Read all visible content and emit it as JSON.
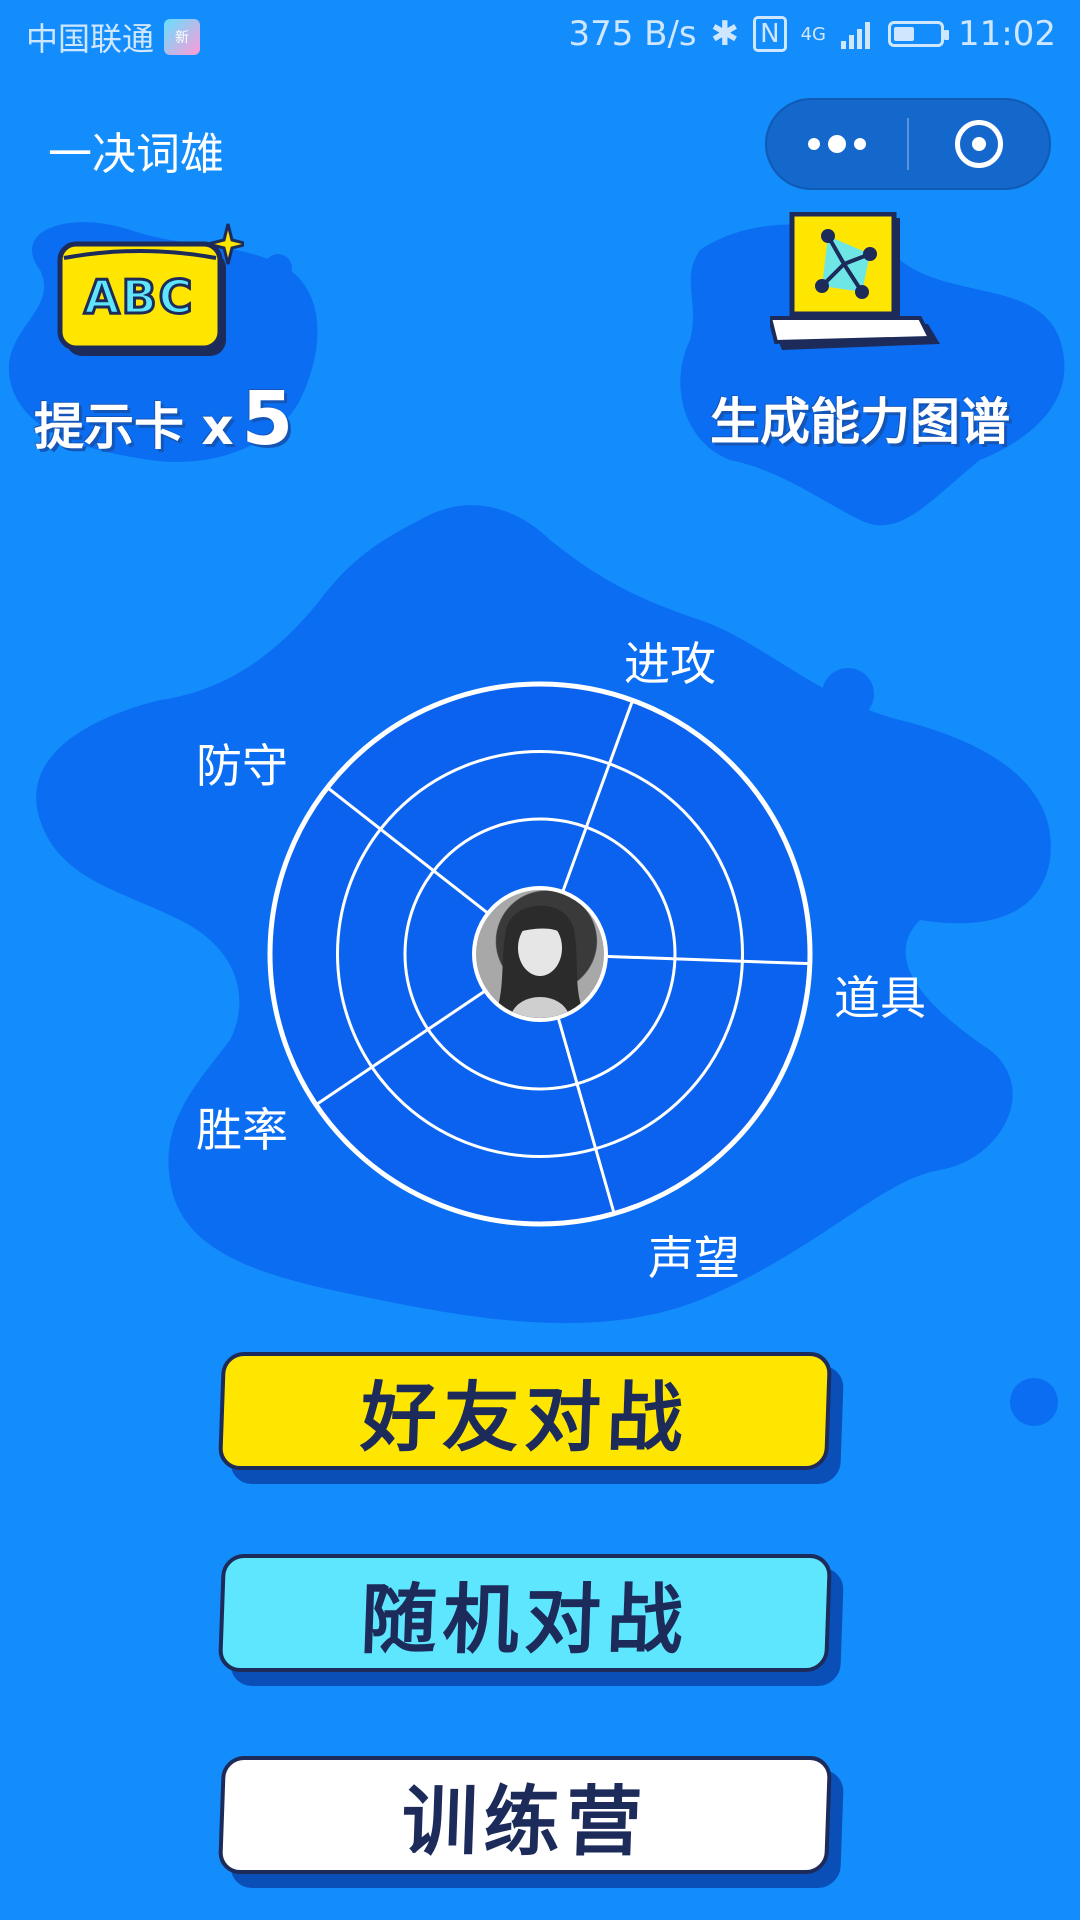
{
  "status_bar": {
    "carrier": "中国联通",
    "carrier_badge": "新",
    "net_speed": "375 B/s",
    "network": "4G",
    "time": "11:02",
    "battery_level": 0.45
  },
  "header": {
    "title": "一决词雄"
  },
  "tools": {
    "hint_card_label": "提示卡 x",
    "hint_card_count": "5",
    "hint_card_icon_text": "ABC",
    "ability_map_label": "生成能力图谱"
  },
  "radar": {
    "axes": [
      "进攻",
      "道具",
      "声望",
      "胜率",
      "防守"
    ]
  },
  "buttons": {
    "friend_battle": "好友对战",
    "random_battle": "随机对战",
    "training_camp": "训练营"
  },
  "colors": {
    "background": "#138dfb",
    "blob": "#0b6ef2",
    "yellow": "#ffe600",
    "cyan": "#5ee6ff",
    "white": "#ffffff",
    "dark_navy": "#1c2b5a"
  }
}
